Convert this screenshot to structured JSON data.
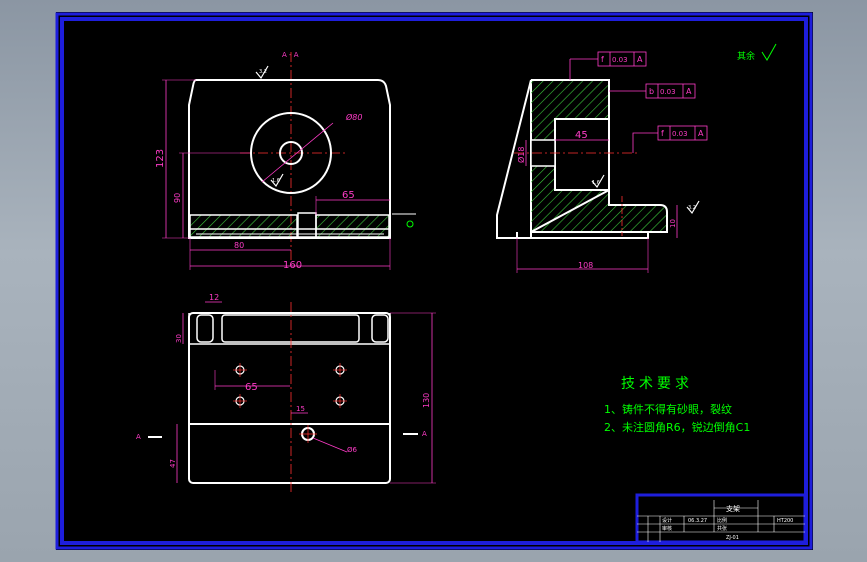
{
  "title": "",
  "colors": {
    "background": "#000000",
    "frame": "#1e1edc",
    "outline": "#ffffff",
    "dimension": "#ff3cc8",
    "centerline": "#ff3030",
    "hatch": "#3cc83c",
    "text": "#00ff00",
    "annotation": "#ffffff"
  },
  "views": {
    "section_label": "A - A",
    "section_arrow_left": "A",
    "section_arrow_right": "A",
    "front": {
      "dim_height_total": "123",
      "dim_height_bore": "90",
      "dim_diameter": "Ø80",
      "dim_width_total": "160",
      "dim_half_width": "80",
      "dim_offset": "65",
      "roughness_top": "3.2",
      "roughness_bore": "1.6"
    },
    "side": {
      "tol_top": [
        "f",
        "0.03",
        "A"
      ],
      "tol_mid": [
        "b",
        "0.03",
        "A"
      ],
      "tol_bore": [
        "f",
        "0.03",
        "A"
      ],
      "dim_slot": "45",
      "dim_bore": "Ø18",
      "dim_base": "108",
      "dim_base_height": "10",
      "roughness_inner": "1.6",
      "roughness_base": "3.2"
    },
    "top": {
      "dim_slot_width": "12",
      "dim_slot_depth": "30",
      "dim_hole_spacing": "65",
      "dim_hole_offset": "15",
      "dim_length": "130",
      "dim_bottom": "47",
      "dim_hole": "Ø6"
    }
  },
  "roughness_note": "其余",
  "requirements": {
    "heading": "技术要求",
    "items": [
      "1、铸件不得有砂眼，裂纹",
      "2、未注圆角R6，锐边倒角C1"
    ]
  },
  "title_block": {
    "part_name": "支架",
    "material": "HT200",
    "date": "06.3.27",
    "drawing_no": "ZJ-01",
    "designer": "设计",
    "checker": "审核",
    "label_1": "比例",
    "label_2": "共张"
  }
}
